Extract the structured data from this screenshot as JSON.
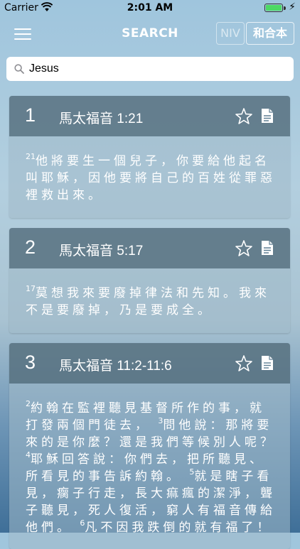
{
  "status_bar": {
    "carrier": "Carrier",
    "time": "2:01 AM",
    "battery_level": 1.0
  },
  "nav": {
    "title": "SEARCH",
    "versions": [
      "NIV",
      "和合本"
    ],
    "active_version": "和合本"
  },
  "search": {
    "value": "Jesus",
    "icon": "search-icon"
  },
  "results": [
    {
      "index": "1",
      "reference": "馬太福音 1:21",
      "segments": [
        {
          "verse": "21",
          "text": "他將要生一個兒子，你要給他起名叫耶穌，因他要將自己的百姓從罪惡裡救出來。"
        }
      ]
    },
    {
      "index": "2",
      "reference": "馬太福音 5:17",
      "segments": [
        {
          "verse": "17",
          "text": "莫想我來要廢掉律法和先知。我來不是要廢掉，乃是要成全。"
        }
      ]
    },
    {
      "index": "3",
      "reference": "馬太福音 11:2-11:6",
      "segments": [
        {
          "verse": "2",
          "text": "約翰在監裡聽見基督所作的事，就打發兩個門徒去，"
        },
        {
          "verse": "3",
          "text": "問他說：那將要來的是你麼？還是我們等候別人呢？"
        },
        {
          "verse": "4",
          "text": "耶穌回答說：你們去，把所聽見、所看見的事告訴約翰。"
        },
        {
          "verse": "5",
          "text": "就是瞎子看見，瘸子行走，長大痲瘋的潔淨，聾子聽見，死人復活，窮人有福音傳給他們。"
        },
        {
          "verse": "6",
          "text": "凡不因我跌倒的就有福了！"
        }
      ]
    }
  ],
  "icons": {
    "menu": "hamburger-icon",
    "favorite": "star-outline-icon",
    "copy": "document-icon"
  }
}
